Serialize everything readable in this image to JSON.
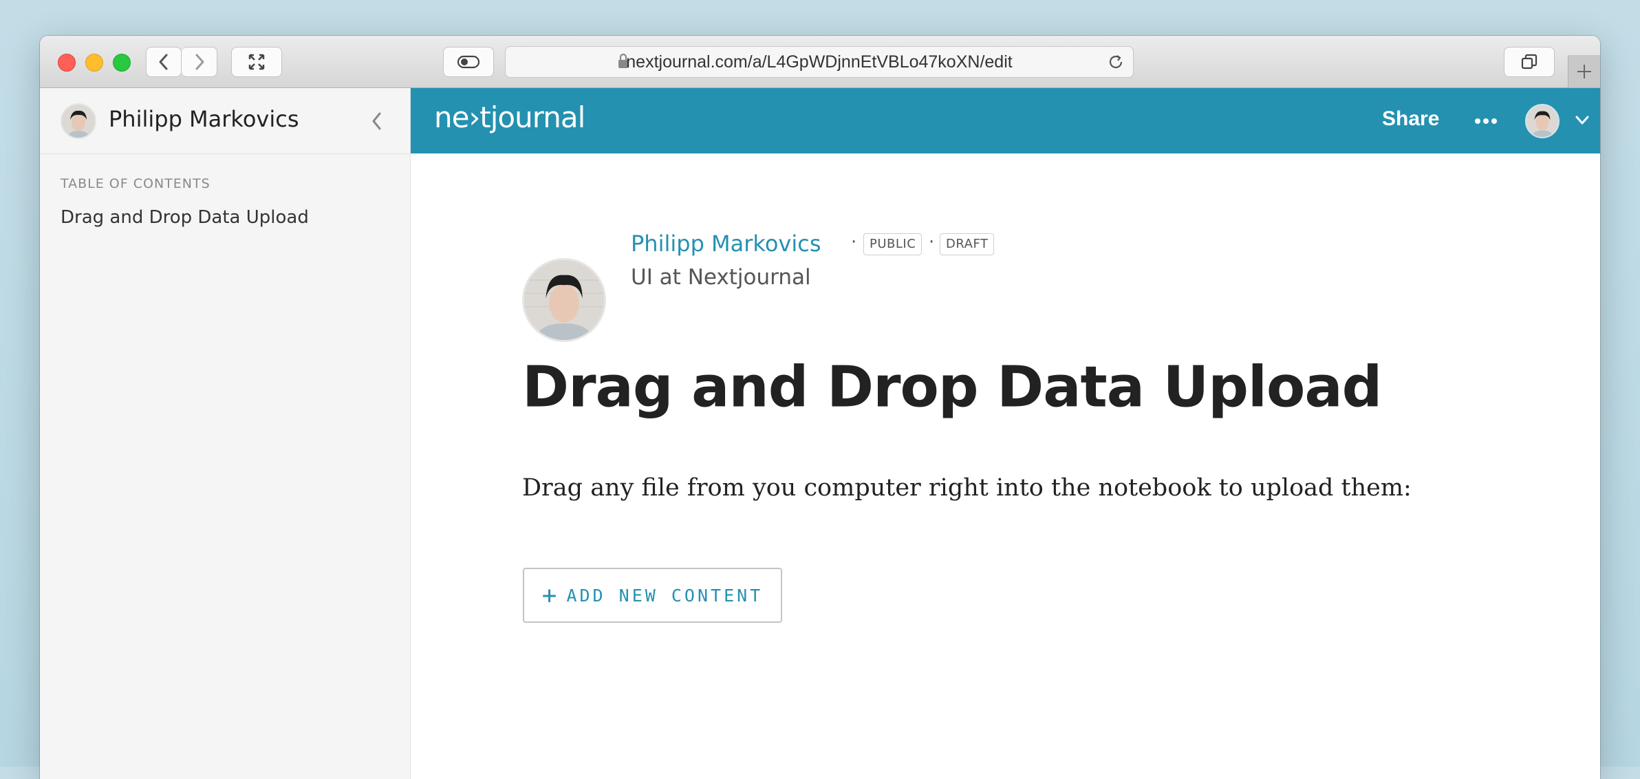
{
  "browser": {
    "url": "nextjournal.com/a/L4GpWDjnnEtVBLo47koXN/edit"
  },
  "sidebar": {
    "user_name": "Philipp Markovics",
    "toc_title": "TABLE OF CONTENTS",
    "toc_items": [
      {
        "label": "Drag and Drop Data Upload"
      }
    ]
  },
  "header": {
    "logo": "ne›tjournal",
    "share_label": "Share"
  },
  "article": {
    "author": "Philipp Markovics",
    "badges": [
      "PUBLIC",
      "DRAFT"
    ],
    "affiliation": "UI at Nextjournal",
    "title": "Drag and Drop Data Upload",
    "body": "Drag any file from you computer right into the notebook to upload them:",
    "add_content_label": "ADD NEW CONTENT"
  },
  "colors": {
    "brand": "#2491b0",
    "sidebar_bg": "#f5f5f5"
  }
}
